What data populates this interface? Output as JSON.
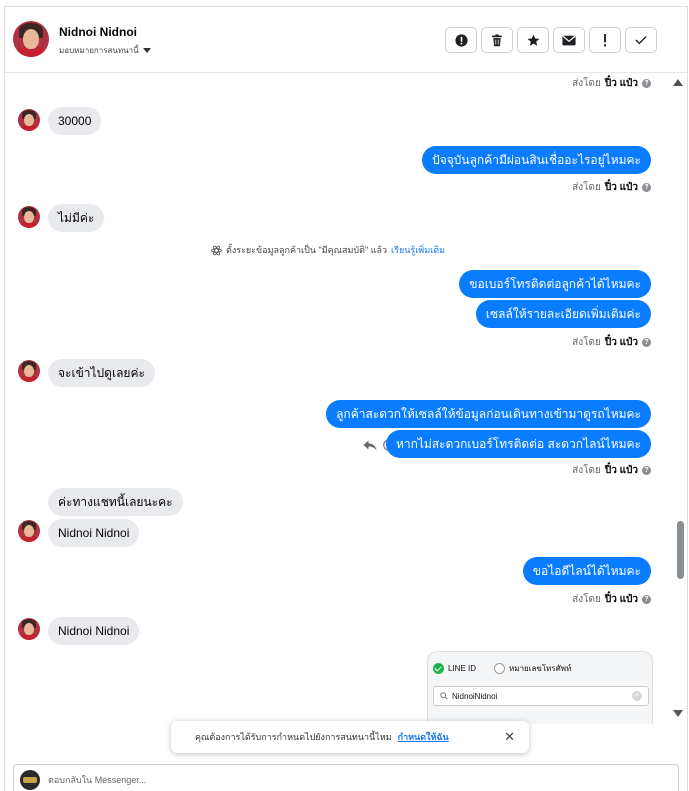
{
  "header": {
    "contact_name": "Nidnoi Nidnoi",
    "assign_label": "มอบหมายการสนทนานี้",
    "actions": [
      {
        "icon": "alert-circle-icon",
        "name": "mark-spam-button"
      },
      {
        "icon": "trash-icon",
        "name": "delete-button"
      },
      {
        "icon": "star-icon",
        "name": "star-button"
      },
      {
        "icon": "envelope-icon",
        "name": "mark-unread-button"
      },
      {
        "icon": "exclamation-icon",
        "name": "follow-up-button"
      },
      {
        "icon": "check-icon",
        "name": "mark-done-button"
      }
    ]
  },
  "sent_status": {
    "prefix": "ส่งโดย",
    "sender": "ปิ๋ว แป๋ว",
    "help": "?"
  },
  "messages": {
    "in_1": "30000",
    "out_1": "ปัจจุบันลูกค้ามีผ่อนสินเชื่ออะไรอยู่ไหมคะ",
    "in_2": "ไม่มีค่ะ",
    "system_note": "ตั้งระยะข้อมูลลูกค้าเป็น \"มีคุณสมบัติ\" แล้ว",
    "system_link": "เรียนรู้เพิ่มเติม",
    "out_2": "ขอเบอร์โทรติดต่อลูกค้าได้ไหมคะ",
    "out_3": "เซลล์ให้รายละเอียดเพิ่มเติมค่ะ",
    "in_3": "จะเข้าไปดูเลยค่ะ",
    "out_4": "ลูกค้าสะดวกให้เซลล์ให้ข้อมูลก่อนเดินทางเข้ามาดูรถไหมคะ",
    "out_5": "หากไม่สะดวกเบอร์โทรติดต่อ สะดวกไลน์ไหมคะ",
    "in_4": "ค่ะทางแชทนี้เลยนะคะ",
    "in_5": "Nidnoi Nidnoi",
    "out_6": "ขอไอดีไลน์ได้ไหมคะ",
    "in_6": "Nidnoi Nidnoi"
  },
  "image_card": {
    "option_line": "LINE ID",
    "option_phone": "หมายเลขโทรศัพท์",
    "search_value": "NidnoiNidnoi"
  },
  "toast": {
    "text": "คุณต้องการได้รับการกำหนดไปยังการสนทนานี้ไหม",
    "link": "กำหนดให้ฉัน",
    "close": "✕"
  },
  "composer": {
    "placeholder": "ตอบกลับใน Messenger..."
  },
  "colors": {
    "outgoing_bubble": "#0a7cff",
    "incoming_bubble": "#e9eaed",
    "link": "#1877f2"
  }
}
